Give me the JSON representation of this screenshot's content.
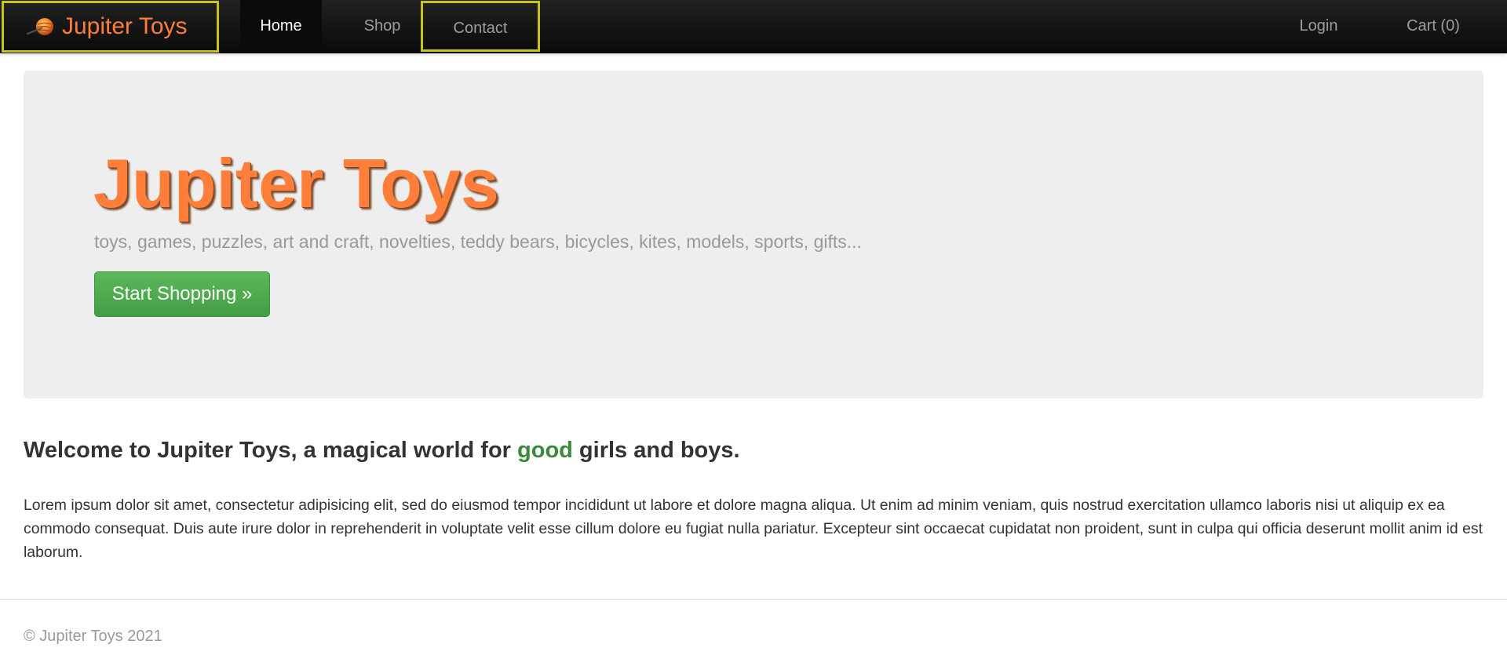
{
  "navbar": {
    "brand_label": "Jupiter Toys",
    "brand_icon": "planet-icon",
    "links": {
      "home": "Home",
      "shop": "Shop",
      "contact": "Contact"
    },
    "right": {
      "login": "Login",
      "cart": "Cart (0)"
    },
    "active": "Home",
    "highlight_color": "#c9c21a"
  },
  "hero": {
    "title": "Jupiter Toys",
    "subtitle": "toys, games, puzzles, art and craft, novelties, teddy bears, bicycles, kites, models, sports, gifts...",
    "button_label": "Start Shopping »",
    "title_color": "#ff7f3a",
    "button_color": "#5cb85c"
  },
  "welcome": {
    "before": "Welcome to Jupiter Toys, a magical world for ",
    "emphasis": "good",
    "after": " girls and boys."
  },
  "body_text": "Lorem ipsum dolor sit amet, consectetur adipisicing elit, sed do eiusmod tempor incididunt ut labore et dolore magna aliqua. Ut enim ad minim veniam, quis nostrud exercitation ullamco laboris nisi ut aliquip ex ea commodo consequat. Duis aute irure dolor in reprehenderit in voluptate velit esse cillum dolore eu fugiat nulla pariatur. Excepteur sint occaecat cupidatat non proident, sunt in culpa qui officia deserunt mollit anim id est laborum.",
  "footer": {
    "copyright": "© Jupiter Toys 2021"
  }
}
